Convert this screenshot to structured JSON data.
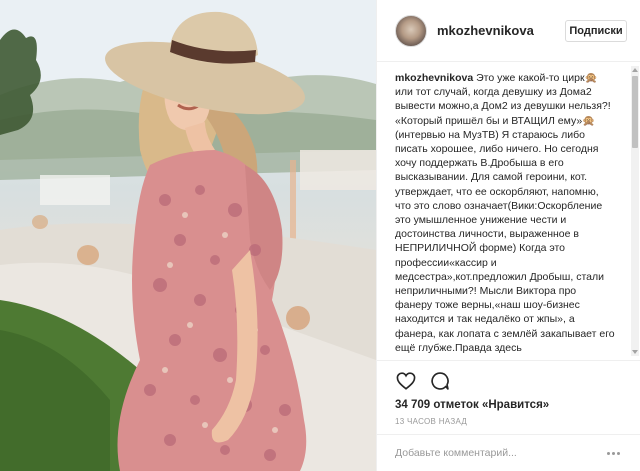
{
  "header": {
    "username": "mkozhevnikova",
    "follow_label": "Подписки"
  },
  "caption": {
    "username": "mkozhevnikova",
    "text": "Это уже какой-то цирк🙊 или тот случай, когда девушку из Дома2 вывести можно,а Дом2 из девушки нельзя?! «Который пришёл бы и ВТАЩИЛ ему»🙊(интервью на МузТВ) Я стараюсь либо писать хорошее, либо ничего. Но сегодня хочу поддержать В.Дробыша в его высказывании. Для самой героини, кот. утверждает, что ее оскорбляют, напомню, что это слово означает(Вики:Оскорбление это умышленное унижение чести и достоинства личности, выраженное в НЕПРИЛИЧНОЙ форме) Когда это профессии«кассир и медсестра»,кот.предложил Дробыш, стали неприличными?! Мысли Виктора про фанеру тоже верны,«наш шоу-бизнес находится и так недалёко от жпы», а фанера, как лопата с землёй закапывает его ещё глубже.Правда здесь"
  },
  "actions": {
    "like_icon": "heart-outline-icon",
    "comment_icon": "speech-bubble-icon",
    "likes_text": "34 709 отметок «Нравится»",
    "time_text": "13 часов назад"
  },
  "comment_box": {
    "placeholder": "Добавьте комментарий...",
    "more_icon": "ellipsis-icon"
  },
  "colors": {
    "text": "#262626",
    "muted": "#999999",
    "border": "#efefef",
    "dress": "#d98f8f",
    "hat": "#d8c4a4",
    "hat_band": "#5a3a2e",
    "grass": "#4e7a33"
  }
}
